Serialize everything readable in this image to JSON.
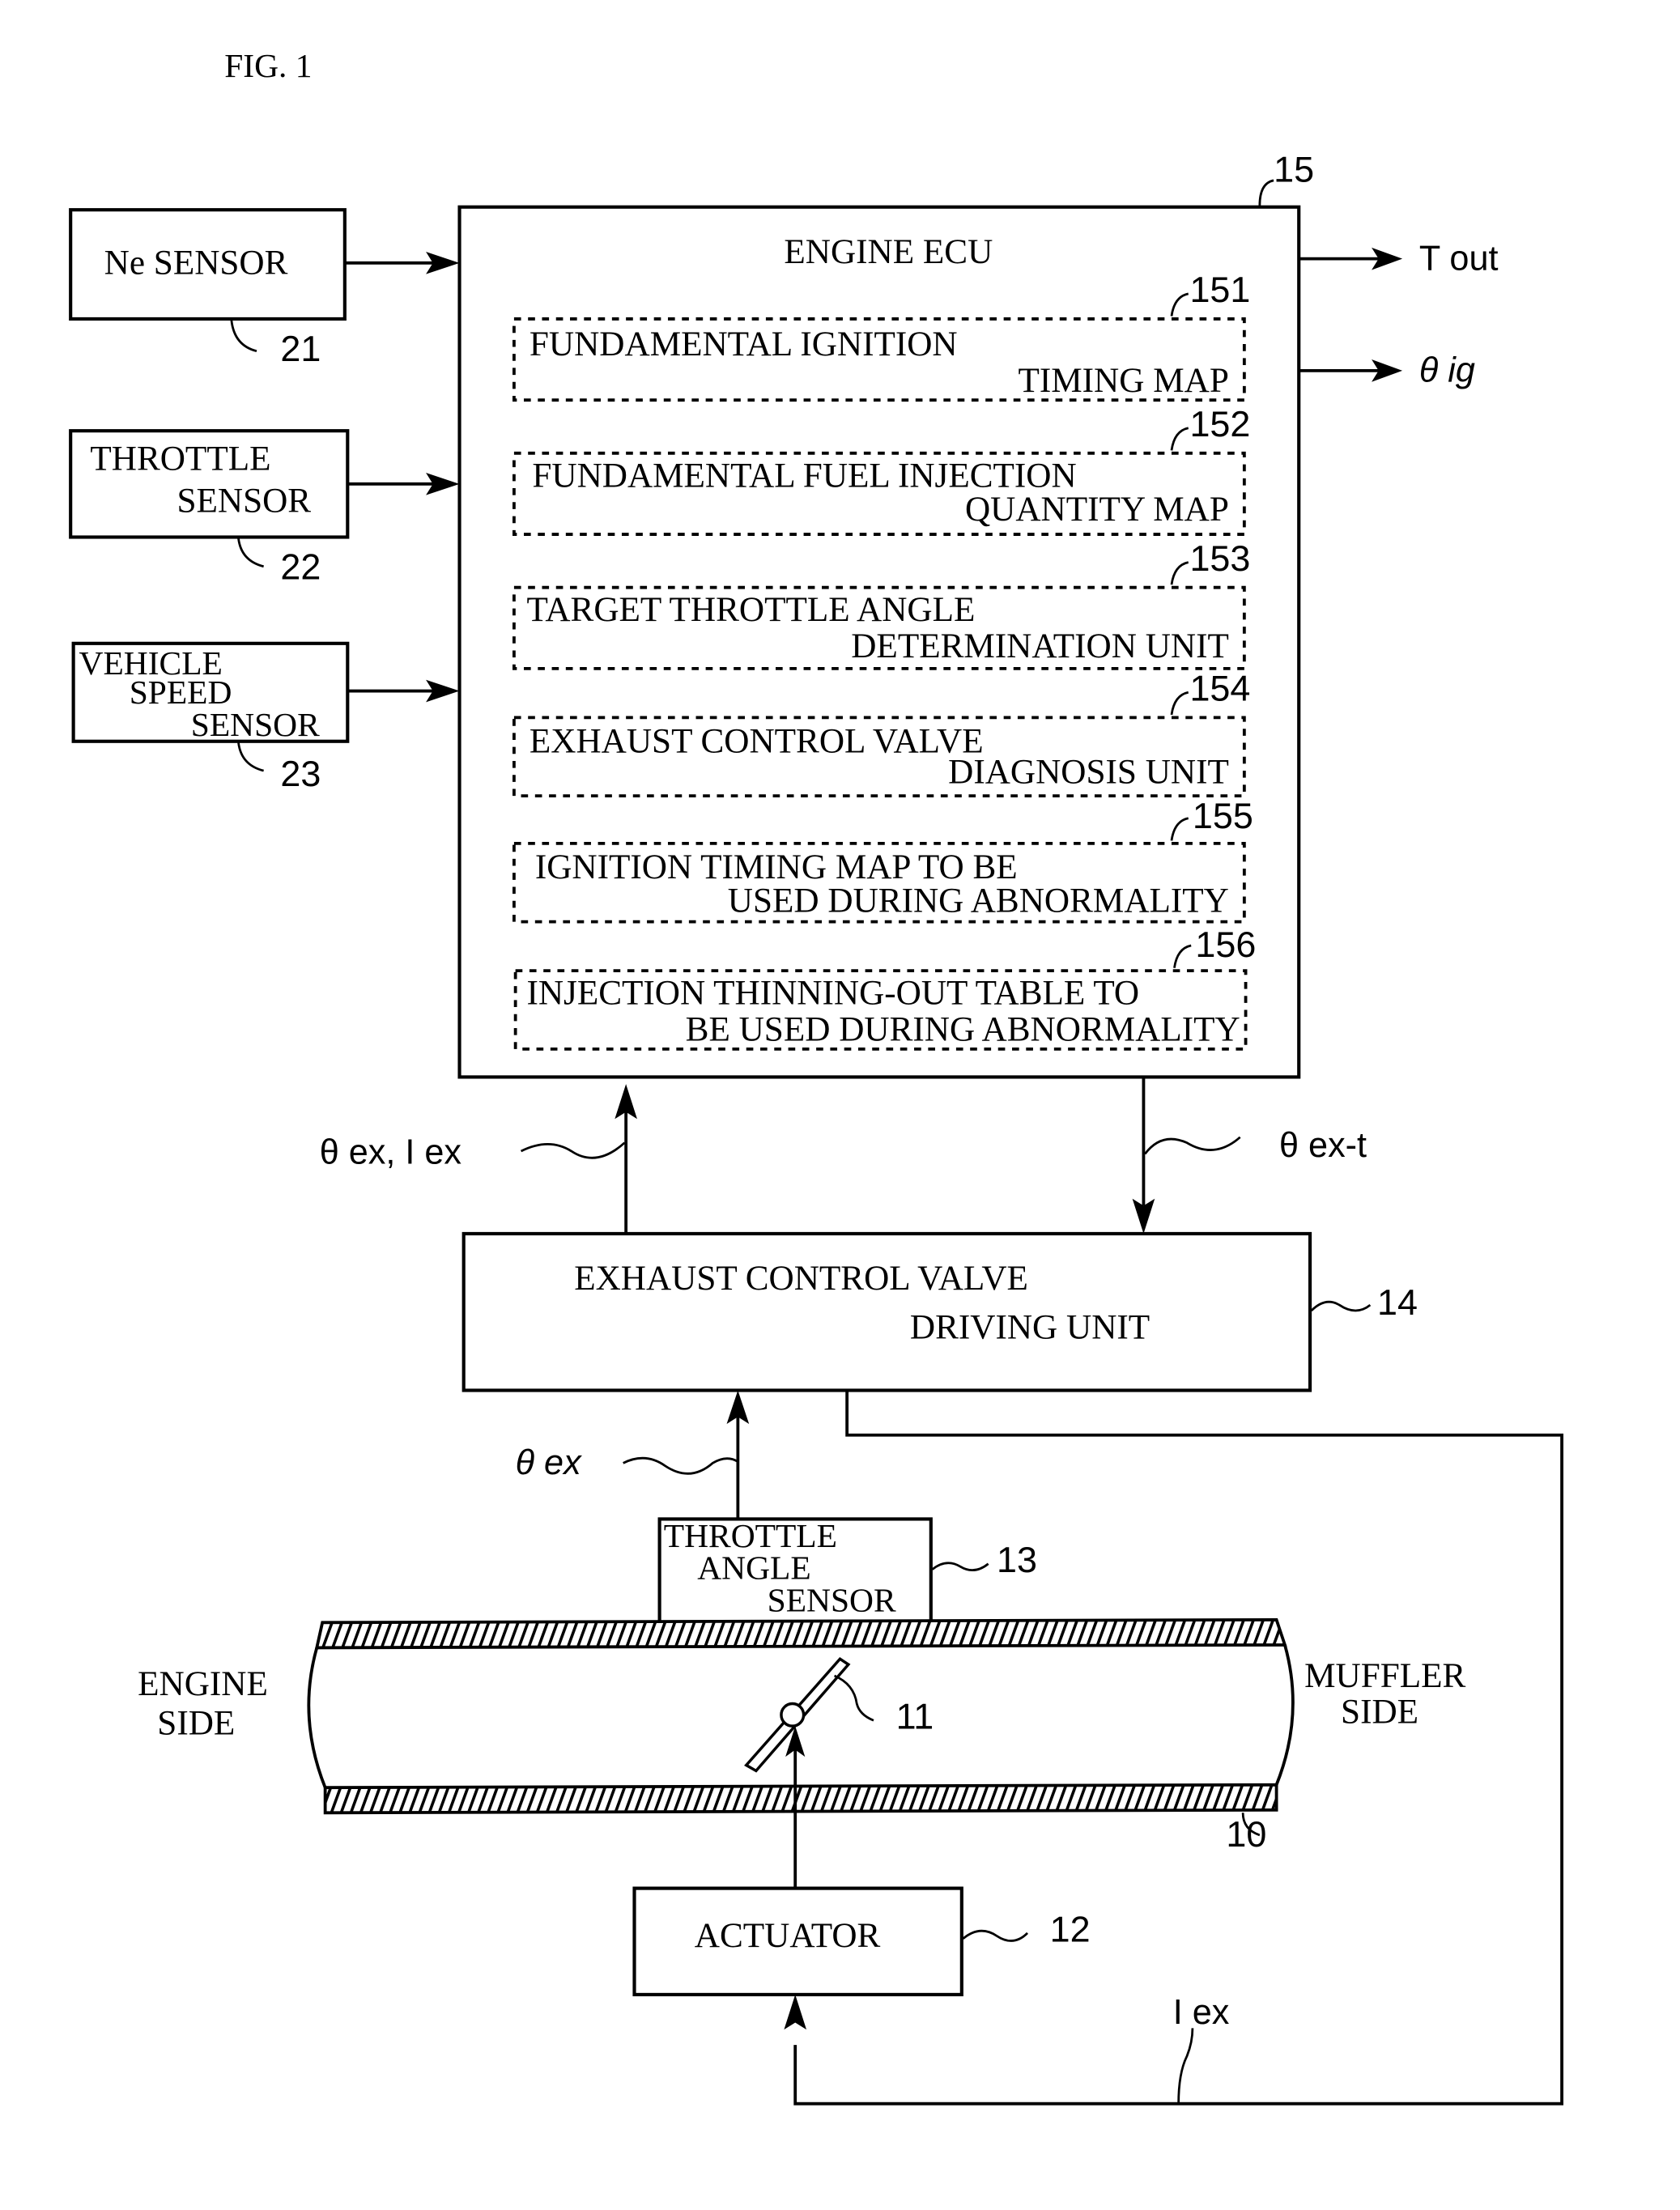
{
  "figure": {
    "title": "FIG. 1"
  },
  "sensors": [
    {
      "lines": [
        "Ne SENSOR"
      ],
      "ref": "21"
    },
    {
      "lines": [
        "THROTTLE",
        "SENSOR"
      ],
      "ref": "22"
    },
    {
      "lines": [
        "VEHICLE",
        "SPEED",
        "SENSOR"
      ],
      "ref": "23"
    }
  ],
  "ecu": {
    "title": "ENGINE ECU",
    "ref": "15",
    "outputs": [
      "T out",
      "θ ig"
    ],
    "modules": [
      {
        "ref": "151",
        "line1": "FUNDAMENTAL IGNITION",
        "line2": "TIMING MAP"
      },
      {
        "ref": "152",
        "line1": "FUNDAMENTAL FUEL INJECTION",
        "line2": "QUANTITY MAP"
      },
      {
        "ref": "153",
        "line1": "TARGET THROTTLE ANGLE",
        "line2": "DETERMINATION UNIT"
      },
      {
        "ref": "154",
        "line1": "EXHAUST CONTROL VALVE",
        "line2": "DIAGNOSIS UNIT"
      },
      {
        "ref": "155",
        "line1": "IGNITION TIMING MAP TO BE",
        "line2": "USED DURING ABNORMALITY"
      },
      {
        "ref": "156",
        "line1": "INJECTION THINNING-OUT TABLE TO",
        "line2": "BE USED DURING ABNORMALITY"
      }
    ]
  },
  "signals": {
    "to_ecu": "θ ex, I ex",
    "from_ecu": "θ ex-t",
    "from_throttle_angle_sensor": "θ ex",
    "to_actuator": "I ex"
  },
  "driving_unit": {
    "line1": "EXHAUST CONTROL VALVE",
    "line2": "DRIVING UNIT",
    "ref": "14"
  },
  "throttle_angle_sensor": {
    "lines": [
      "THROTTLE",
      "ANGLE",
      "SENSOR"
    ],
    "ref": "13"
  },
  "pipe": {
    "ref": "10",
    "valve_ref": "11",
    "left_label": [
      "ENGINE",
      "SIDE"
    ],
    "right_label": [
      "MUFFLER",
      "SIDE"
    ]
  },
  "actuator": {
    "label": "ACTUATOR",
    "ref": "12"
  }
}
